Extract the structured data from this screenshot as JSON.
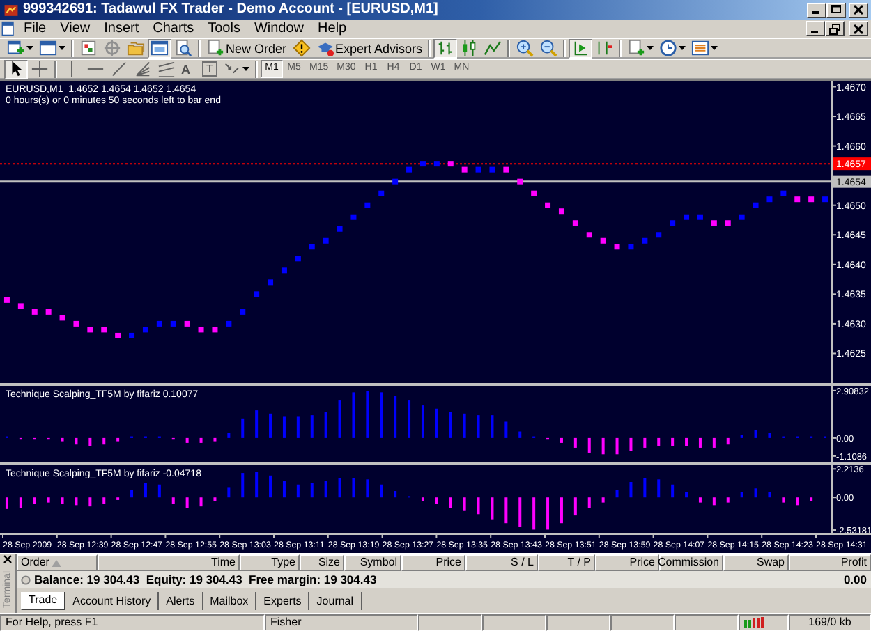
{
  "window": {
    "title": "999342691: Tadawul FX Trader - Demo Account - [EURUSD,M1]"
  },
  "menu": [
    "File",
    "View",
    "Insert",
    "Charts",
    "Tools",
    "Window",
    "Help"
  ],
  "toolbars": {
    "standard": [
      {
        "kind": "dropdown",
        "pressed": false
      },
      {
        "kind": "dropdown",
        "pressed": false
      },
      {
        "kind": "separator"
      },
      {
        "kind": "icon",
        "pressed": false
      },
      {
        "kind": "icon",
        "pressed": false
      },
      {
        "kind": "icon",
        "pressed": false
      },
      {
        "kind": "icon",
        "pressed": true
      },
      {
        "kind": "icon",
        "pressed": false
      },
      {
        "kind": "separator"
      },
      {
        "kind": "button",
        "label": "New Order"
      },
      {
        "kind": "icon",
        "pressed": false
      },
      {
        "kind": "button",
        "label": "Expert Advisors"
      },
      {
        "kind": "separator"
      },
      {
        "kind": "icon",
        "pressed": true
      },
      {
        "kind": "icon",
        "pressed": false
      },
      {
        "kind": "icon",
        "pressed": false
      },
      {
        "kind": "separator"
      },
      {
        "kind": "icon",
        "pressed": false
      },
      {
        "kind": "icon",
        "pressed": false
      },
      {
        "kind": "separator"
      },
      {
        "kind": "icon",
        "pressed": true
      },
      {
        "kind": "icon",
        "pressed": false
      },
      {
        "kind": "separator"
      },
      {
        "kind": "dropdown",
        "pressed": false
      },
      {
        "kind": "dropdown",
        "pressed": false
      },
      {
        "kind": "dropdown",
        "pressed": false
      }
    ],
    "drawing": [
      {
        "kind": "icon",
        "pressed": true
      },
      {
        "kind": "icon",
        "pressed": false
      },
      {
        "kind": "separator"
      },
      {
        "kind": "icon",
        "pressed": false
      },
      {
        "kind": "icon",
        "pressed": false
      },
      {
        "kind": "icon",
        "pressed": false
      },
      {
        "kind": "icon",
        "pressed": false
      },
      {
        "kind": "icon",
        "pressed": false
      },
      {
        "kind": "text-tool",
        "label": "A"
      },
      {
        "kind": "label-tool",
        "label": "T"
      },
      {
        "kind": "dropdown",
        "pressed": false
      }
    ],
    "timeframes": [
      {
        "label": "M1",
        "selected": true
      },
      {
        "label": "M5",
        "selected": false
      },
      {
        "label": "M15",
        "selected": false
      },
      {
        "label": "M30",
        "selected": false
      },
      {
        "label": "H1",
        "selected": false
      },
      {
        "label": "H4",
        "selected": false
      },
      {
        "label": "D1",
        "selected": false
      },
      {
        "label": "W1",
        "selected": false
      },
      {
        "label": "MN",
        "selected": false
      }
    ]
  },
  "chart": {
    "panes": [
      {
        "info": "0 hours(s) or 0 minutes 50 seconds left to bar end",
        "chart_data": {
          "type": "scatter",
          "title": "EURUSD,M1  1.4652 1.4654 1.4652 1.4654",
          "ylim": [
            1.462,
            1.4671
          ],
          "yticks": [
            {
              "value": 1.467,
              "label": "1.4670"
            },
            {
              "value": 1.4665,
              "label": "1.4665"
            },
            {
              "value": 1.466,
              "label": "1.4660"
            },
            {
              "value": 1.465,
              "label": "1.4650"
            },
            {
              "value": 1.4645,
              "label": "1.4645"
            },
            {
              "value": 1.464,
              "label": "1.4640"
            },
            {
              "value": 1.4635,
              "label": "1.4635"
            },
            {
              "value": 1.463,
              "label": "1.4630"
            },
            {
              "value": 1.4625,
              "label": "1.4625"
            }
          ],
          "ref_lines": [
            {
              "axis": "y",
              "value": 1.4657,
              "label": "1.4657",
              "color": "#ff0000"
            },
            {
              "axis": "y",
              "value": 1.4654,
              "label": "1.4654",
              "color": "#c0c0c0"
            }
          ],
          "series": [
            {
              "color": "#0000ff",
              "values": [
                null,
                null,
                null,
                null,
                null,
                null,
                null,
                null,
                null,
                1.4628,
                1.4629,
                1.463,
                1.463,
                null,
                null,
                null,
                1.463,
                1.4632,
                1.4635,
                1.4637,
                1.4639,
                1.4641,
                1.4643,
                1.4644,
                1.4646,
                1.4648,
                1.465,
                1.4652,
                1.4654,
                1.4656,
                1.4657,
                1.4657,
                null,
                null,
                1.4656,
                1.4656,
                null,
                null,
                null,
                null,
                null,
                null,
                null,
                null,
                null,
                1.4643,
                1.4644,
                1.4645,
                1.4647,
                1.4648,
                1.4648,
                null,
                null,
                1.4648,
                1.465,
                1.4651,
                1.4652,
                null,
                null,
                1.4651
              ]
            },
            {
              "color": "#ff00ff",
              "values": [
                1.4634,
                1.4633,
                1.4632,
                1.4632,
                1.4631,
                1.463,
                1.4629,
                1.4629,
                1.4628,
                null,
                null,
                null,
                null,
                1.463,
                1.4629,
                1.4629,
                null,
                null,
                null,
                null,
                null,
                null,
                null,
                null,
                null,
                null,
                null,
                null,
                null,
                null,
                null,
                null,
                1.4657,
                1.4656,
                null,
                null,
                1.4656,
                1.4654,
                1.4652,
                1.465,
                1.4649,
                1.4647,
                1.4645,
                1.4644,
                1.4643,
                null,
                null,
                null,
                null,
                null,
                null,
                1.4647,
                1.4647,
                null,
                null,
                null,
                null,
                1.4651,
                1.4651,
                null
              ]
            }
          ]
        }
      },
      {
        "chart_data": {
          "type": "bar",
          "title": "Technique Scalping_TF5M by fifariz 0.10077",
          "ylim": [
            -1.5,
            3.2
          ],
          "yticks": [
            {
              "value": 2.90832,
              "label": "2.90832"
            },
            {
              "value": 0,
              "label": "0.00"
            },
            {
              "value": -1.1086,
              "label": "-1.1086"
            }
          ],
          "series": [
            {
              "color": "#0000ff",
              "values": [
                0.1,
                null,
                null,
                null,
                null,
                null,
                null,
                null,
                null,
                0.1,
                0.1,
                0.1,
                null,
                null,
                null,
                null,
                0.3,
                1.2,
                1.7,
                1.5,
                1.3,
                1.3,
                1.4,
                1.6,
                2.3,
                2.8,
                2.9,
                2.8,
                2.6,
                2.3,
                2.0,
                1.8,
                1.6,
                1.5,
                1.4,
                1.4,
                1.0,
                0.4,
                0.1,
                null,
                null,
                null,
                null,
                null,
                null,
                null,
                null,
                null,
                null,
                null,
                null,
                null,
                null,
                0.2,
                0.5,
                0.3,
                0.1,
                0.1,
                0.1,
                0.1
              ]
            },
            {
              "color": "#ff00ff",
              "values": [
                null,
                -0.1,
                -0.1,
                -0.1,
                -0.2,
                -0.4,
                -0.5,
                -0.4,
                -0.2,
                null,
                null,
                null,
                -0.1,
                -0.3,
                -0.3,
                -0.2,
                null,
                null,
                null,
                null,
                null,
                null,
                null,
                null,
                null,
                null,
                null,
                null,
                null,
                null,
                null,
                null,
                null,
                null,
                null,
                null,
                null,
                null,
                null,
                -0.1,
                -0.3,
                -0.6,
                -0.9,
                -1.0,
                -1.0,
                -0.8,
                -0.6,
                -0.5,
                -0.5,
                -0.5,
                -0.6,
                -0.6,
                -0.4,
                null,
                null,
                null,
                null,
                null,
                null,
                null
              ]
            }
          ]
        }
      },
      {
        "chart_data": {
          "type": "bar",
          "title": "Technique Scalping_TF5M by fifariz -0.04718",
          "ylim": [
            -2.8,
            2.5
          ],
          "yticks": [
            {
              "value": 2.2136,
              "label": "2.2136"
            },
            {
              "value": 0,
              "label": "0.00"
            },
            {
              "value": -2.53181,
              "label": "-2.53181"
            }
          ],
          "series": [
            {
              "color": "#0000ff",
              "values": [
                null,
                null,
                null,
                null,
                null,
                null,
                null,
                null,
                null,
                0.6,
                1.1,
                1.0,
                null,
                null,
                null,
                null,
                0.8,
                1.9,
                2.0,
                1.7,
                1.3,
                1.0,
                1.1,
                1.3,
                1.5,
                1.5,
                1.4,
                1.0,
                0.5,
                0.1,
                null,
                null,
                null,
                null,
                null,
                null,
                null,
                null,
                null,
                null,
                null,
                null,
                null,
                null,
                0.6,
                1.2,
                1.5,
                1.4,
                1.0,
                0.4,
                null,
                null,
                null,
                0.4,
                0.7,
                0.4,
                null,
                null,
                null,
                null
              ]
            },
            {
              "color": "#ff00ff",
              "values": [
                -0.9,
                -0.8,
                -0.5,
                -0.4,
                -0.5,
                -0.6,
                -0.7,
                -0.5,
                -0.2,
                null,
                null,
                null,
                -0.5,
                -0.8,
                -0.7,
                -0.3,
                null,
                null,
                null,
                null,
                null,
                null,
                null,
                null,
                null,
                null,
                null,
                null,
                null,
                null,
                -0.3,
                -0.5,
                -0.8,
                -1.0,
                -1.3,
                -1.7,
                -2.0,
                -2.3,
                -2.5,
                -2.5,
                -2.0,
                -1.4,
                -0.8,
                -0.4,
                null,
                null,
                null,
                null,
                null,
                null,
                -0.4,
                -0.6,
                -0.4,
                null,
                null,
                null,
                -0.4,
                -0.6,
                -0.3,
                null
              ]
            }
          ]
        }
      }
    ],
    "time_axis": [
      "28 Sep 2009",
      "28 Sep 12:39",
      "28 Sep 12:47",
      "28 Sep 12:55",
      "28 Sep 13:03",
      "28 Sep 13:11",
      "28 Sep 13:19",
      "28 Sep 13:27",
      "28 Sep 13:35",
      "28 Sep 13:43",
      "28 Sep 13:51",
      "28 Sep 13:59",
      "28 Sep 14:07",
      "28 Sep 14:15",
      "28 Sep 14:23",
      "28 Sep 14:31"
    ]
  },
  "terminal": {
    "side_label": "Terminal",
    "columns": [
      {
        "label": "Order",
        "sorted": true
      },
      {
        "label": "Time",
        "sorted": false
      },
      {
        "label": "Type",
        "sorted": false
      },
      {
        "label": "Size",
        "sorted": false
      },
      {
        "label": "Symbol",
        "sorted": false
      },
      {
        "label": "Price",
        "sorted": false
      },
      {
        "label": "S / L",
        "sorted": false
      },
      {
        "label": "T / P",
        "sorted": false
      },
      {
        "label": "Price",
        "sorted": false
      },
      {
        "label": "Commission",
        "sorted": false
      },
      {
        "label": "Swap",
        "sorted": false
      },
      {
        "label": "Profit",
        "sorted": false
      }
    ],
    "summary": {
      "text": "Balance: 19 304.43  Equity: 19 304.43  Free margin: 19 304.43",
      "profit": "0.00"
    },
    "tabs": [
      {
        "label": "Trade",
        "selected": true
      },
      {
        "label": "Account History",
        "selected": false
      },
      {
        "label": "Alerts",
        "selected": false
      },
      {
        "label": "Mailbox",
        "selected": false
      },
      {
        "label": "Experts",
        "selected": false
      },
      {
        "label": "Journal",
        "selected": false
      }
    ]
  },
  "status_bar": {
    "help": "For Help, press F1",
    "profile": "Fisher",
    "traffic": "169/0 kb"
  }
}
